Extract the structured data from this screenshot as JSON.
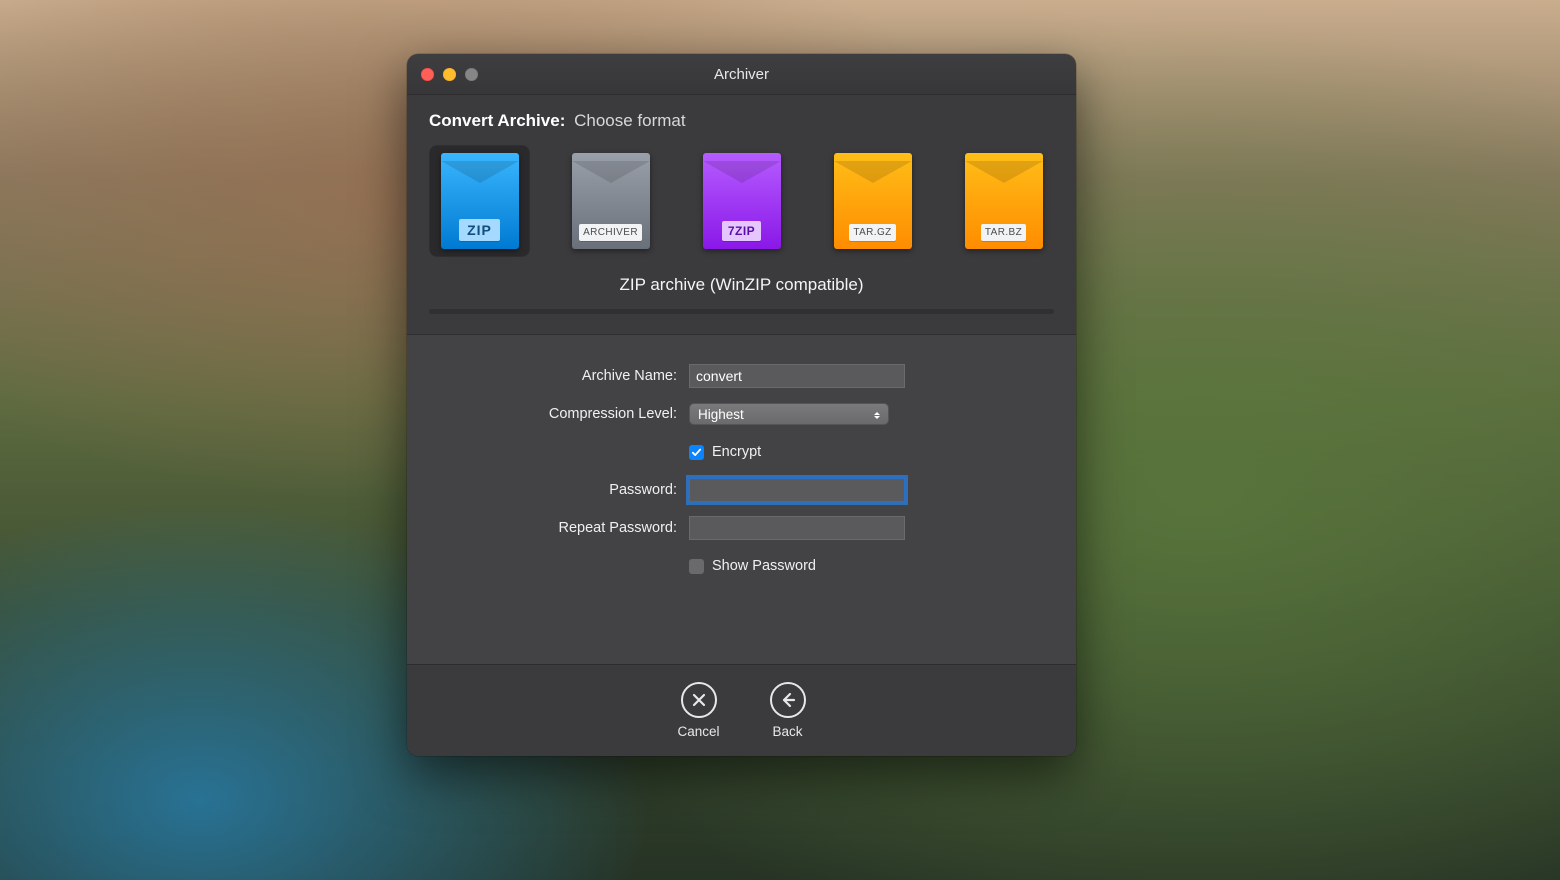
{
  "window": {
    "title": "Archiver"
  },
  "header": {
    "title_bold": "Convert Archive:",
    "title_rest": "Choose format"
  },
  "formats": {
    "zip": {
      "tag": "ZIP",
      "selected": true
    },
    "archiver": {
      "tag": "ARCHIVER",
      "selected": false
    },
    "sevenzip": {
      "tag": "7ZIP",
      "selected": false
    },
    "targz": {
      "tag": "TAR.GZ",
      "selected": false
    },
    "tarbz": {
      "tag": "TAR.BZ",
      "selected": false
    }
  },
  "format_description": "ZIP archive (WinZIP compatible)",
  "form": {
    "archive_name_label": "Archive Name:",
    "archive_name_value": "convert",
    "compression_label": "Compression Level:",
    "compression_value": "Highest",
    "encrypt_label": "Encrypt",
    "encrypt_checked": true,
    "password_label": "Password:",
    "password_value": "",
    "repeat_password_label": "Repeat Password:",
    "repeat_password_value": "",
    "show_password_label": "Show Password",
    "show_password_checked": false
  },
  "footer": {
    "cancel_label": "Cancel",
    "back_label": "Back"
  }
}
